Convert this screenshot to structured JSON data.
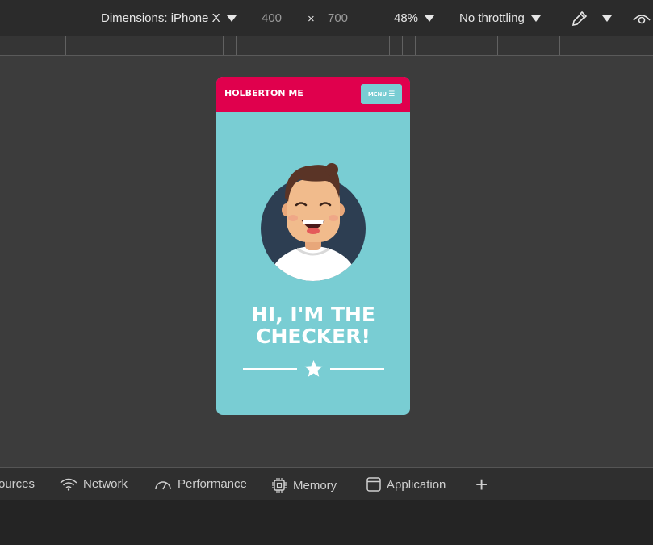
{
  "toolbar": {
    "dimensions_label": "Dimensions: iPhone X",
    "width": "400",
    "times": "×",
    "height": "700",
    "zoom": "48%",
    "throttling": "No throttling"
  },
  "site": {
    "brand": "HOLBERTON ME",
    "menu_label": "MENU",
    "hero_line1": "HI, I'M THE",
    "hero_line2": "CHECKER!"
  },
  "tabs": [
    {
      "label": "ources"
    },
    {
      "label": "Network",
      "icon": "wifi-icon"
    },
    {
      "label": "Performance",
      "icon": "gauge-icon"
    },
    {
      "label": "Memory",
      "icon": "chip-icon"
    },
    {
      "label": "Application",
      "icon": "window-icon"
    }
  ],
  "add_tab": "+"
}
